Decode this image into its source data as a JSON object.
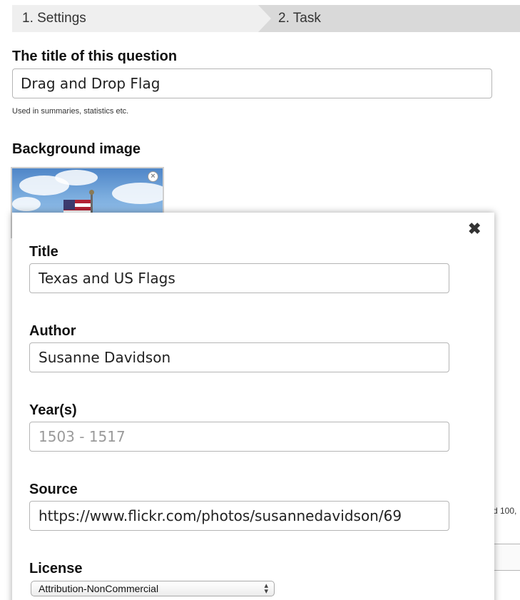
{
  "wizard": {
    "step1_label": "1. Settings",
    "step2_label": "2. Task"
  },
  "form": {
    "title_label": "The title of this question",
    "title_value": "Drag and Drop Flag",
    "title_help": "Used in summaries, statistics etc.",
    "background_label": "Background image"
  },
  "background_fragment": {
    "text": "d 100,"
  },
  "dialog": {
    "close_icon": "close-icon",
    "title_label": "Title",
    "title_value": "Texas and US Flags",
    "author_label": "Author",
    "author_value": "Susanne Davidson",
    "years_label": "Year(s)",
    "years_placeholder": "1503 - 1517",
    "source_label": "Source",
    "source_value": "https://www.flickr.com/photos/susannedavidson/69",
    "license_label": "License",
    "license_value": "Attribution-NonCommercial"
  }
}
